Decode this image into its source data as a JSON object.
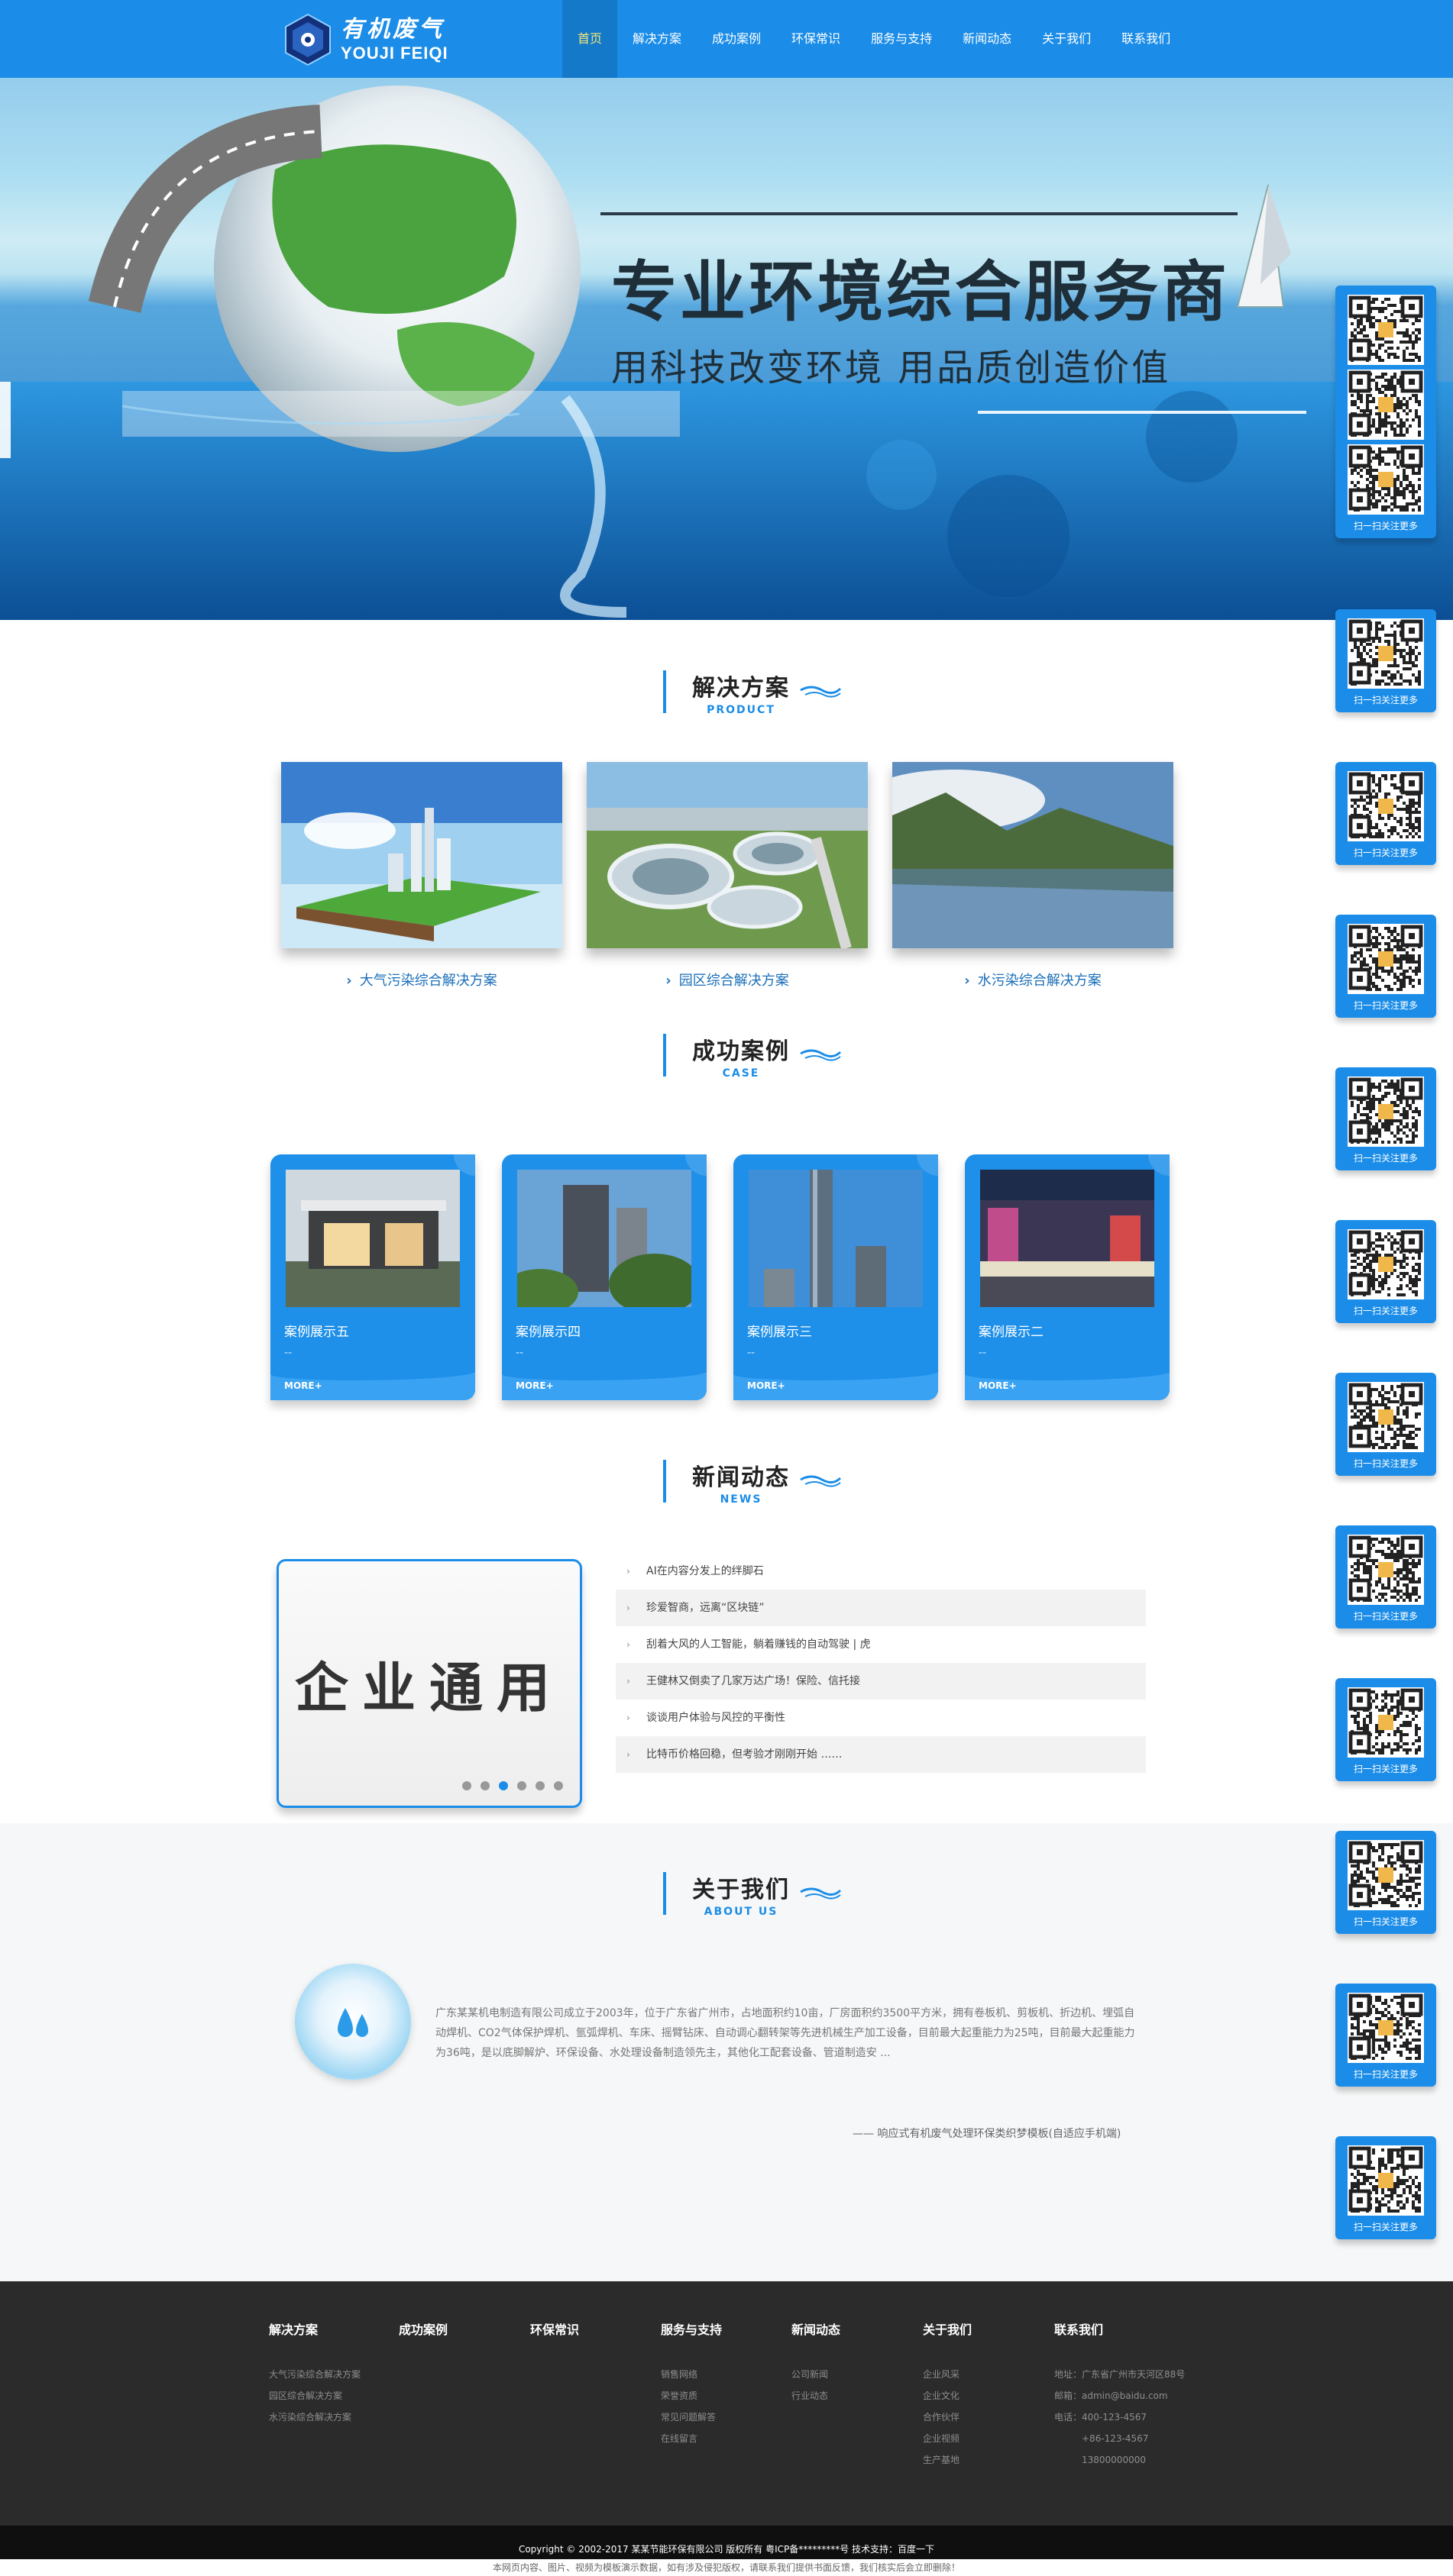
{
  "logo": {
    "cn": "有机废气",
    "en": "YOUJI FEIQI"
  },
  "nav": [
    {
      "label": "首页",
      "active": true
    },
    {
      "label": "解决方案"
    },
    {
      "label": "成功案例"
    },
    {
      "label": "环保常识"
    },
    {
      "label": "服务与支持"
    },
    {
      "label": "新闻动态"
    },
    {
      "label": "关于我们"
    },
    {
      "label": "联系我们"
    }
  ],
  "banner": {
    "title": "专业环境综合服务商",
    "subtitle": "用科技改变环境   用品质创造价值"
  },
  "solutions": {
    "title": "解决方案",
    "en": "PRODUCT",
    "items": [
      {
        "label": "大气污染综合解决方案"
      },
      {
        "label": "园区综合解决方案"
      },
      {
        "label": "水污染综合解决方案"
      }
    ]
  },
  "cases": {
    "title": "成功案例",
    "en": "CASE",
    "more_label": "MORE+",
    "dash": "--",
    "items": [
      {
        "name": "案例展示五"
      },
      {
        "name": "案例展示四"
      },
      {
        "name": "案例展示三"
      },
      {
        "name": "案例展示二"
      }
    ]
  },
  "news": {
    "title": "新闻动态",
    "en": "NEWS",
    "feature_text": "企业通用",
    "items": [
      "AI在内容分发上的绊脚石",
      "珍爱智商，远离“区块链”",
      "刮着大风的人工智能，躺着赚钱的自动驾驶 | 虎",
      "王健林又倒卖了几家万达广场！保险、信托接",
      "谈谈用户体验与风控的平衡性",
      "比特币价格回稳，但考验才刚刚开始 ……"
    ]
  },
  "about": {
    "title": "关于我们",
    "en": "ABOUT US",
    "text": "广东某某机电制造有限公司成立于2003年，位于广东省广州市，占地面积约10亩，厂房面积约3500平方米，拥有卷板机、剪板机、折边机、埋弧自动焊机、CO2气体保护焊机、氩弧焊机、车床、摇臂钻床、自动调心翻转架等先进机械生产加工设备，目前最大起重能力为25吨，目前最大起重能力为36吨，是以底脚解炉、环保设备、水处理设备制造领先主，其他化工配套设备、管道制造安 ...",
    "signature": "—— 响应式有机废气处理环保类织梦模板(自适应手机端)"
  },
  "footer": {
    "columns": [
      {
        "title": "解决方案",
        "links": [
          "大气污染综合解决方案",
          "园区综合解决方案",
          "水污染综合解决方案"
        ]
      },
      {
        "title": "成功案例",
        "links": []
      },
      {
        "title": "环保常识",
        "links": []
      },
      {
        "title": "服务与支持",
        "links": [
          "销售网络",
          "荣誉资质",
          "常见问题解答",
          "在线留言"
        ]
      },
      {
        "title": "新闻动态",
        "links": [
          "公司新闻",
          "行业动态"
        ]
      },
      {
        "title": "关于我们",
        "links": [
          "企业风采",
          "企业文化",
          "合作伙伴",
          "企业视频",
          "生产基地"
        ]
      },
      {
        "title": "联系我们",
        "links": [
          "地址：广东省广州市天河区88号",
          "邮箱：admin@baidu.com",
          "电话：400-123-4567",
          "+86-123-4567",
          "13800000000"
        ]
      }
    ],
    "copyright": "Copyright © 2002-2017 某某节能环保有限公司 版权所有   粤ICP备*********号   技术支持：百度一下",
    "notice": "本网页内容、图片、视频为模板演示数据，如有涉及侵犯版权，请联系我们提供书面反馈，我们核实后会立即删除！"
  },
  "qr": {
    "caption": "扫一扫关注更多"
  },
  "colors": {
    "primary": "#1b8de8",
    "footer": "#2b2b2b",
    "active_nav_text": "#f4e67a"
  }
}
